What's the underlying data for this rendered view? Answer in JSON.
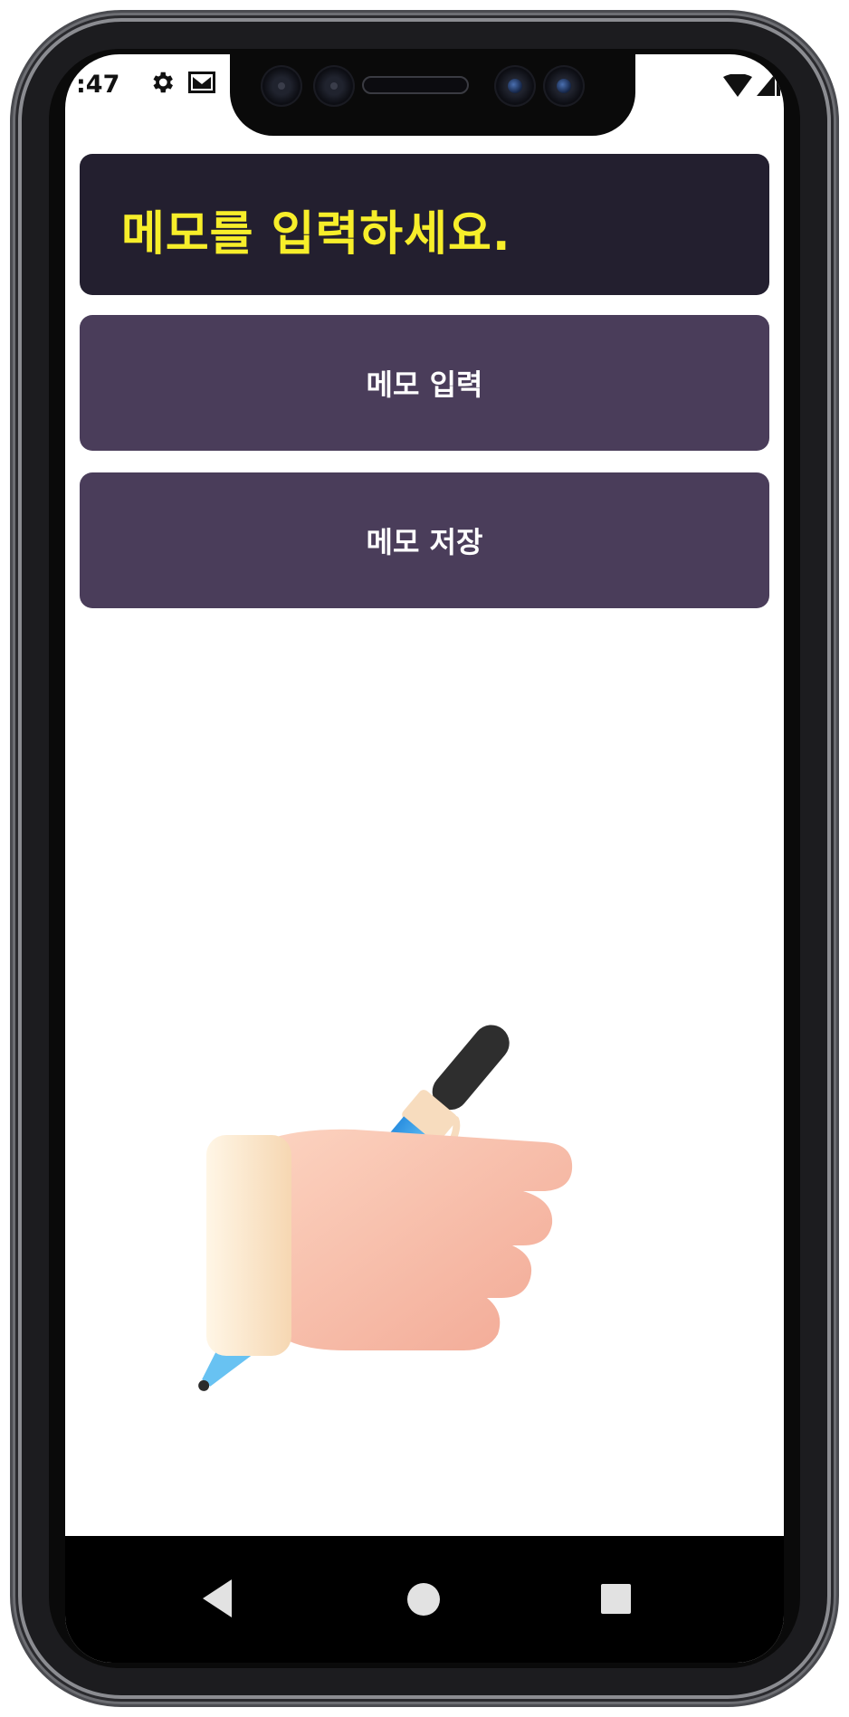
{
  "status_bar": {
    "time": ":47",
    "icons": [
      "gear-icon",
      "mail-icon",
      "wifi-icon",
      "signal-icon"
    ]
  },
  "memo": {
    "placeholder_text": "메모를 입력하세요."
  },
  "buttons": {
    "input_label": "메모 입력",
    "save_label": "메모 저장"
  },
  "illustration": {
    "icon": "hand-holding-pen-icon"
  },
  "nav_bar": {
    "icons": [
      "back-icon",
      "home-icon",
      "recent-apps-icon"
    ]
  },
  "colors": {
    "banner_bg": "#231f2f",
    "banner_text": "#f7ee2a",
    "button_bg": "#4a3d5a",
    "button_text": "#ffffff",
    "nav_bg": "#000000"
  }
}
